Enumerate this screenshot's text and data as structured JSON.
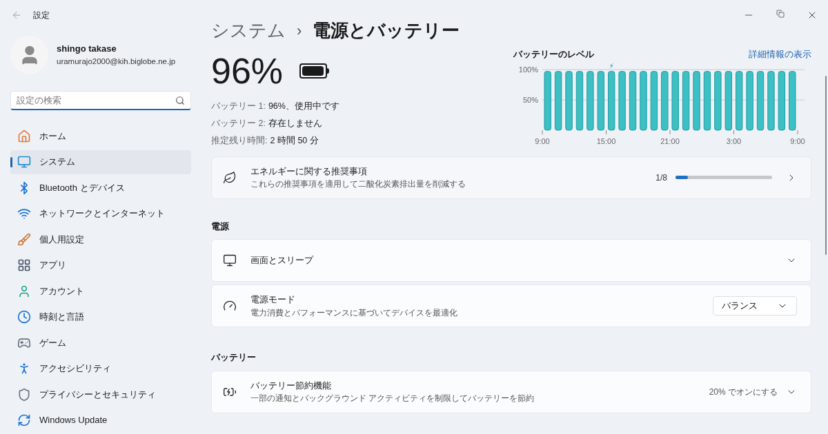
{
  "window": {
    "title": "設定"
  },
  "user": {
    "name": "shingo takase",
    "email": "uramurajo2000@kih.biglobe.ne.jp"
  },
  "search": {
    "placeholder": "設定の検索"
  },
  "sidebar": {
    "items": [
      {
        "label": "ホーム",
        "selected": false
      },
      {
        "label": "システム",
        "selected": true
      },
      {
        "label": "Bluetooth とデバイス",
        "selected": false
      },
      {
        "label": "ネットワークとインターネット",
        "selected": false
      },
      {
        "label": "個人用設定",
        "selected": false
      },
      {
        "label": "アプリ",
        "selected": false
      },
      {
        "label": "アカウント",
        "selected": false
      },
      {
        "label": "時刻と言語",
        "selected": false
      },
      {
        "label": "ゲーム",
        "selected": false
      },
      {
        "label": "アクセシビリティ",
        "selected": false
      },
      {
        "label": "プライバシーとセキュリティ",
        "selected": false
      },
      {
        "label": "Windows Update",
        "selected": false
      }
    ]
  },
  "breadcrumb": {
    "parent": "システム",
    "separator": "›",
    "current": "電源とバッテリー"
  },
  "battery": {
    "percent": "96%",
    "level": 0.96,
    "details": [
      {
        "label": "バッテリー 1:",
        "value": "96%、使用中です"
      },
      {
        "label": "バッテリー 2:",
        "value": "存在しません"
      },
      {
        "label": "推定残り時間:",
        "value": "2 時間 50 分"
      }
    ]
  },
  "battery_chart": {
    "title": "バッテリーのレベル",
    "link": "詳細情報の表示",
    "chart_data": {
      "type": "bar",
      "ylim": [
        0,
        100
      ],
      "yticks": [
        {
          "value": 50,
          "label": "50%"
        },
        {
          "value": 100,
          "label": "100%"
        }
      ],
      "categories": [
        "9:00",
        null,
        null,
        null,
        null,
        null,
        "15:00",
        null,
        null,
        null,
        null,
        null,
        "21:00",
        null,
        null,
        null,
        null,
        null,
        "3:00",
        null,
        null,
        null,
        null,
        null,
        "9:00"
      ],
      "values": [
        97,
        97,
        97,
        97,
        97,
        97,
        97,
        97,
        97,
        97,
        97,
        97,
        97,
        97,
        97,
        97,
        97,
        97,
        97,
        97,
        97,
        97,
        97,
        97,
        null
      ],
      "annotations": [
        {
          "text": "⚡",
          "x": "15:00",
          "y": 100
        }
      ]
    }
  },
  "recommendation": {
    "title": "エネルギーに関する推奨事項",
    "subtitle": "これらの推奨事項を適用して二酸化炭素排出量を削減する",
    "count": "1/8",
    "level": 0.125
  },
  "sections": [
    {
      "heading": "電源",
      "rows": [
        {
          "kind": "expander",
          "title": "画面とスリープ"
        },
        {
          "kind": "dropdown",
          "title": "電源モード",
          "subtitle": "電力消費とパフォーマンスに基づいてデバイスを最適化",
          "value": "バランス"
        }
      ]
    },
    {
      "heading": "バッテリー",
      "rows": [
        {
          "kind": "expander",
          "title": "バッテリー節約機能",
          "subtitle": "一部の通知とバックグラウンド アクティビティを制限してバッテリーを節約",
          "value": "20% でオンにする"
        }
      ]
    }
  ]
}
